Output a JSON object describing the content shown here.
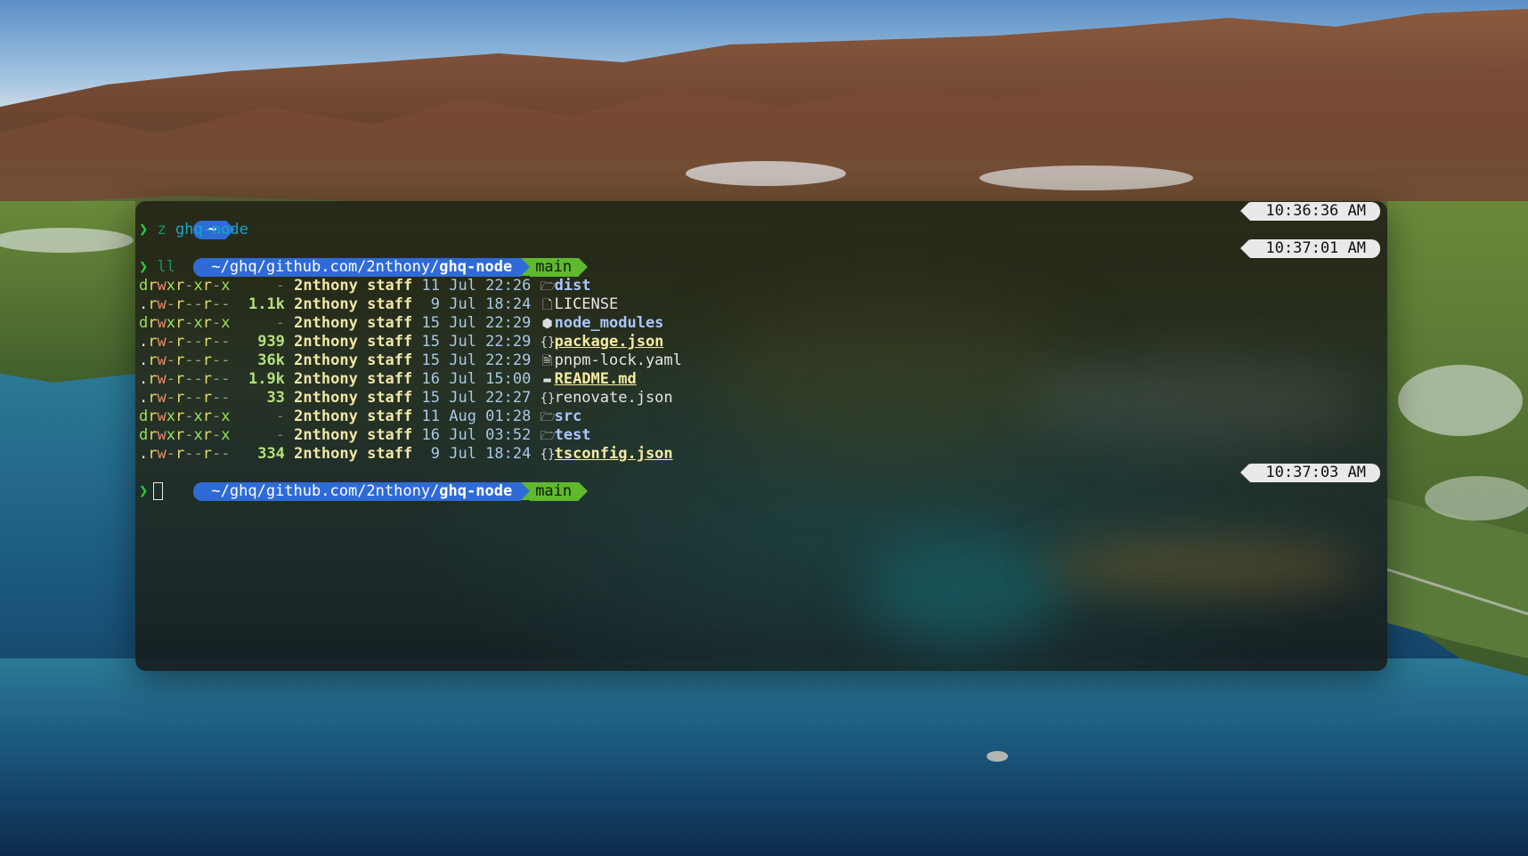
{
  "terminal": {
    "first_prompt": {
      "dir": "~"
    },
    "commands": [
      {
        "prompt_symbol": "❯",
        "text_z": "z",
        "text_arg": "ghq-node",
        "time": "10:36:36 AM"
      },
      {
        "prompt_symbol": "❯",
        "text": "ll",
        "time": "10:37:01 AM"
      }
    ],
    "prompt_path": {
      "prefix": "~/ghq/github.com/2nthony/",
      "dir": "ghq-node",
      "branch": "main"
    },
    "listing": [
      {
        "perm": "drwxr-xr-x",
        "size": "-",
        "user": "2nthony",
        "group": "staff",
        "day": "11",
        "month": "Jul",
        "time": "22:26",
        "icon": "folder-icon",
        "name": "dist",
        "kind": "dir"
      },
      {
        "perm": ".rw-r--r--",
        "size": "1.1k",
        "user": "2nthony",
        "group": "staff",
        "day": "9",
        "month": "Jul",
        "time": "18:24",
        "icon": "file-icon",
        "name": "LICENSE",
        "kind": "file"
      },
      {
        "perm": "drwxr-xr-x",
        "size": "-",
        "user": "2nthony",
        "group": "staff",
        "day": "15",
        "month": "Jul",
        "time": "22:29",
        "icon": "node-icon",
        "name": "node_modules",
        "kind": "dir"
      },
      {
        "perm": ".rw-r--r--",
        "size": "939",
        "user": "2nthony",
        "group": "staff",
        "day": "15",
        "month": "Jul",
        "time": "22:29",
        "icon": "json-icon",
        "name": "package.json",
        "kind": "bold"
      },
      {
        "perm": ".rw-r--r--",
        "size": "36k",
        "user": "2nthony",
        "group": "staff",
        "day": "15",
        "month": "Jul",
        "time": "22:29",
        "icon": "lock-file-icon",
        "name": "pnpm-lock.yaml",
        "kind": "file"
      },
      {
        "perm": ".rw-r--r--",
        "size": "1.9k",
        "user": "2nthony",
        "group": "staff",
        "day": "16",
        "month": "Jul",
        "time": "15:00",
        "icon": "markdown-icon",
        "name": "README.md",
        "kind": "bold"
      },
      {
        "perm": ".rw-r--r--",
        "size": "33",
        "user": "2nthony",
        "group": "staff",
        "day": "15",
        "month": "Jul",
        "time": "22:27",
        "icon": "json-icon",
        "name": "renovate.json",
        "kind": "file"
      },
      {
        "perm": "drwxr-xr-x",
        "size": "-",
        "user": "2nthony",
        "group": "staff",
        "day": "11",
        "month": "Aug",
        "time": "01:28",
        "icon": "folder-icon",
        "name": "src",
        "kind": "dir"
      },
      {
        "perm": "drwxr-xr-x",
        "size": "-",
        "user": "2nthony",
        "group": "staff",
        "day": "16",
        "month": "Jul",
        "time": "03:52",
        "icon": "folder-icon",
        "name": "test",
        "kind": "dir"
      },
      {
        "perm": ".rw-r--r--",
        "size": "334",
        "user": "2nthony",
        "group": "staff",
        "day": "9",
        "month": "Jul",
        "time": "18:24",
        "icon": "json-icon",
        "name": "tsconfig.json",
        "kind": "bold"
      }
    ],
    "final_prompt": {
      "prompt_symbol": "❯",
      "time": "10:37:03 AM"
    }
  },
  "colors": {
    "prompt_blue": "#2f6bd6",
    "branch_green": "#5fb82e",
    "time_pill": "#e9e9e9"
  }
}
